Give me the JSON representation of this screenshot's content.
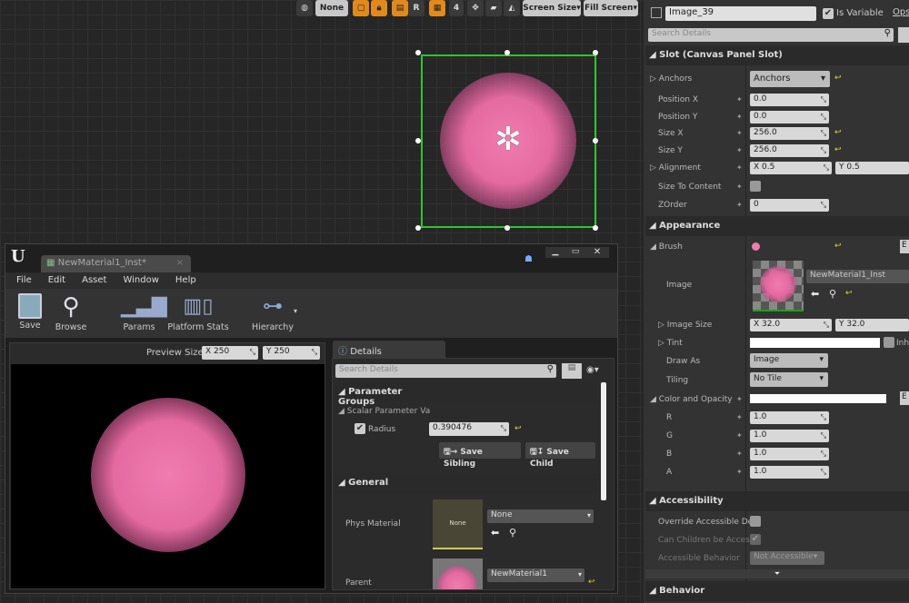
{
  "toolbar": {
    "globe": "globe-icon",
    "none_label": "None",
    "r_label": "R",
    "grid_num": "4",
    "screen_size": "Screen Size",
    "fill_screen": "Fill Screen"
  },
  "colors": {
    "accent_orange": "#e08a1e",
    "selection_green": "#2ec52e",
    "pink": "#f07cb0",
    "reset_yellow": "#e6d23a"
  },
  "details": {
    "widget_name": "Image_39",
    "is_variable_label": "Is Variable",
    "is_variable": true,
    "ops": "Ops",
    "search_placeholder": "Search Details",
    "slot": {
      "title": "Slot (Canvas Panel Slot)",
      "anchors_label": "Anchors",
      "anchors_value": "Anchors",
      "position_x_label": "Position X",
      "position_x": "0.0",
      "position_y_label": "Position Y",
      "position_y": "0.0",
      "size_x_label": "Size X",
      "size_x": "256.0",
      "size_y_label": "Size Y",
      "size_y": "256.0",
      "alignment_label": "Alignment",
      "alignment_x": "X  0.5",
      "alignment_y": "Y  0.5",
      "size_to_content_label": "Size To Content",
      "zorder_label": "ZOrder",
      "zorder": "0"
    },
    "appearance": {
      "title": "Appearance",
      "brush_label": "Brush",
      "image_label": "Image",
      "image_asset": "NewMaterial1_Inst",
      "image_size_label": "Image Size",
      "image_size_x": "X  32.0",
      "image_size_y": "Y  32.0",
      "tint_label": "Tint",
      "tint_inherit": "Inhe",
      "draw_as_label": "Draw As",
      "draw_as": "Image",
      "tiling_label": "Tiling",
      "tiling": "No Tile",
      "color_label": "Color and Opacity",
      "r_label": "R",
      "r": "1.0",
      "g_label": "G",
      "g": "1.0",
      "b_label": "B",
      "b": "1.0",
      "a_label": "A",
      "a": "1.0",
      "e_btn": "E"
    },
    "accessibility": {
      "title": "Accessibility",
      "override_label": "Override Accessible De",
      "children_label": "Can Children be Access",
      "behavior_label": "Accessible Behavior",
      "behavior_value": "Not Accessible"
    },
    "behavior": {
      "title": "Behavior"
    }
  },
  "material_editor": {
    "tab": "NewMaterial1_Inst*",
    "menu": [
      "File",
      "Edit",
      "Asset",
      "Window",
      "Help"
    ],
    "toolbar": [
      "Save",
      "Browse",
      "Params",
      "Platform Stats",
      "Hierarchy"
    ],
    "preview_size_label": "Preview Size",
    "preview_x": "250",
    "preview_y": "250",
    "x": "X",
    "y": "Y",
    "details": {
      "tab": "Details",
      "search_placeholder": "Search Details",
      "param_groups": "Parameter Groups",
      "scalar_group": "Scalar Parameter Va",
      "radius_label": "Radius",
      "radius_enabled": true,
      "radius_value": "0.390476",
      "save_sibling": "Save Sibling",
      "save_child": "Save Child",
      "general": "General",
      "phys_material_label": "Phys Material",
      "phys_thumb": "None",
      "phys_value": "None",
      "parent_label": "Parent",
      "parent_value": "NewMaterial1"
    }
  }
}
